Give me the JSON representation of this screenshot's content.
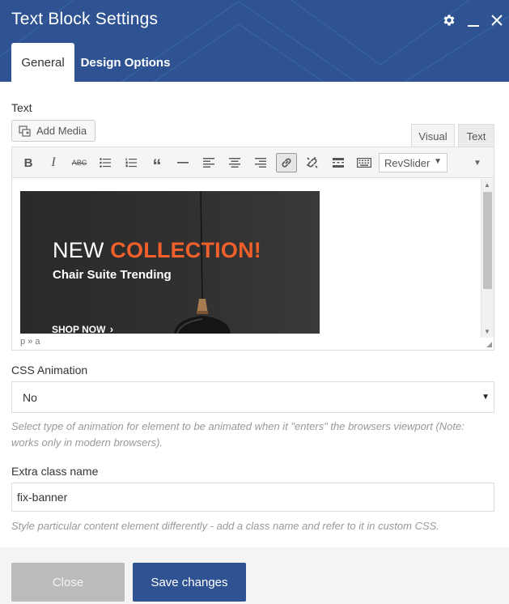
{
  "window": {
    "title": "Text Block Settings",
    "icons": [
      "gear-icon",
      "minimize-icon",
      "close-icon"
    ],
    "accent_color": "#2f5392"
  },
  "tabs": [
    {
      "label": "General",
      "active": true
    },
    {
      "label": "Design Options",
      "active": false
    }
  ],
  "text_field": {
    "label": "Text",
    "add_media_label": "Add Media",
    "mode_tabs": [
      "Visual",
      "Text"
    ],
    "toolbar": {
      "buttons": [
        "bold",
        "italic",
        "strikethrough",
        "bulleted-list",
        "numbered-list",
        "blockquote",
        "horizontal-line",
        "align-left",
        "align-center",
        "align-right",
        "insert-link",
        "remove-link",
        "read-more",
        "toolbar-toggle"
      ],
      "revslider_label": "RevSlider"
    },
    "banner": {
      "headline_plain": "NEW ",
      "headline_accent": "COLLECTION!",
      "subtitle": "Chair Suite Trending",
      "cta": "SHOP NOW",
      "accent_color": "#f0602a"
    },
    "path": "p » a"
  },
  "css_animation": {
    "label": "CSS Animation",
    "selected": "No",
    "help": "Select type of animation for element to be animated when it \"enters\" the browsers viewport (Note: works only in modern browsers)."
  },
  "extra_class": {
    "label": "Extra class name",
    "value": "fix-banner",
    "help": "Style particular content element differently - add a class name and refer to it in custom CSS."
  },
  "footer": {
    "close_label": "Close",
    "save_label": "Save changes"
  }
}
